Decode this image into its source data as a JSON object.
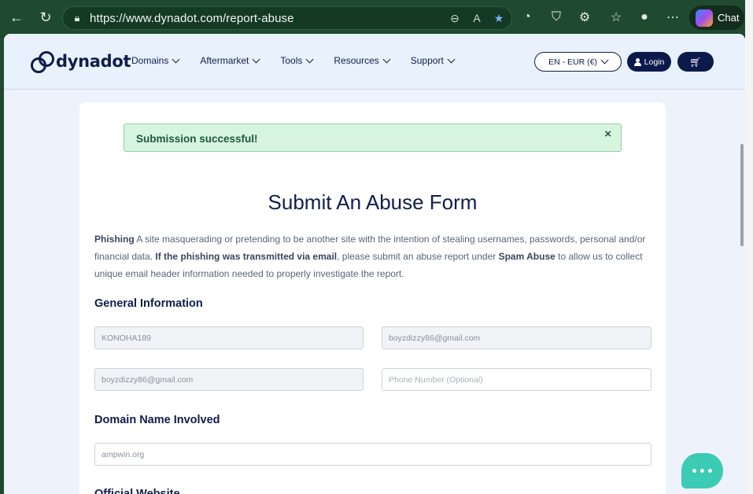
{
  "browser": {
    "url": "https://www.dynadot.com/report-abuse",
    "chat_label": "Chat"
  },
  "header": {
    "logo_text": "dynadot",
    "nav": [
      "Domains",
      "Aftermarket",
      "Tools",
      "Resources",
      "Support"
    ],
    "lang_label": "EN - EUR (€)",
    "login_label": "Login"
  },
  "alert": {
    "text": "Submission successful!",
    "close": "×"
  },
  "form": {
    "title": "Submit An Abuse Form",
    "desc_phishing": "Phishing",
    "desc_part1": " A site masquerading or pretending to be another site with the intention of stealing usernames, passwords, personal and/or financial data. ",
    "desc_bold2": "If the phishing was transmitted via email",
    "desc_part2": ", please submit an abuse report under ",
    "desc_bold3": "Spam Abuse",
    "desc_part3": " to allow us to collect unique email header information needed to properly investigate the report.",
    "section_general": "General Information",
    "field_name": "KONOHA189",
    "field_email1": "boyzdizzy86@gmail.com",
    "field_email2": "boyzdizzy86@gmail.com",
    "field_phone_placeholder": "Phone Number (Optional)",
    "section_domain": "Domain Name Involved",
    "field_domain": "ampwin.org",
    "section_official": "Official Website"
  },
  "colors": {
    "brand": "#0f1e4a",
    "success_bg": "#d7f4df",
    "chat_bubble": "#3ccbb5"
  }
}
